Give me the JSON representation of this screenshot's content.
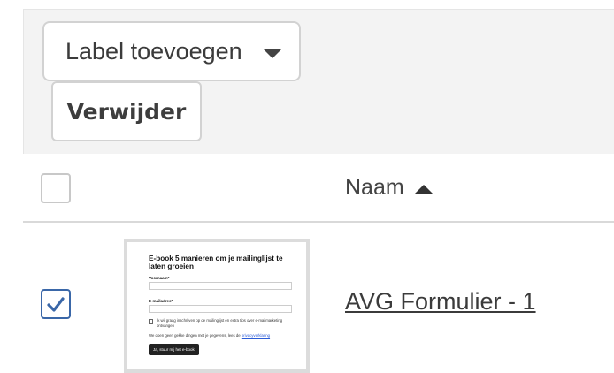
{
  "toolbar": {
    "label_dropdown": "Label toevoegen",
    "delete_label": "Verwijder"
  },
  "table": {
    "columns": {
      "name": "Naam"
    },
    "sort": "ascending",
    "rows": [
      {
        "selected": true,
        "name": "AVG Formulier - 1",
        "thumbnail": {
          "title": "E-book 5 manieren om je mailinglijst te laten groeien",
          "first_name_label": "Voornaam*",
          "email_label": "E-mailadres*",
          "consent_text": "Ik wil graag inschrijven op de mailinglijst en extra tips over e-mailmarketing ontvangen",
          "privacy_text": "We doen geen gekke dingen met je gegevens, lees de",
          "privacy_link": "privacyverklaring",
          "submit_label": "Ja, stuur mij het e-book"
        }
      }
    ]
  },
  "colors": {
    "accent": "#3a67a8",
    "border": "#d2d2d2",
    "toolbar_bg": "#f3f3f3"
  }
}
